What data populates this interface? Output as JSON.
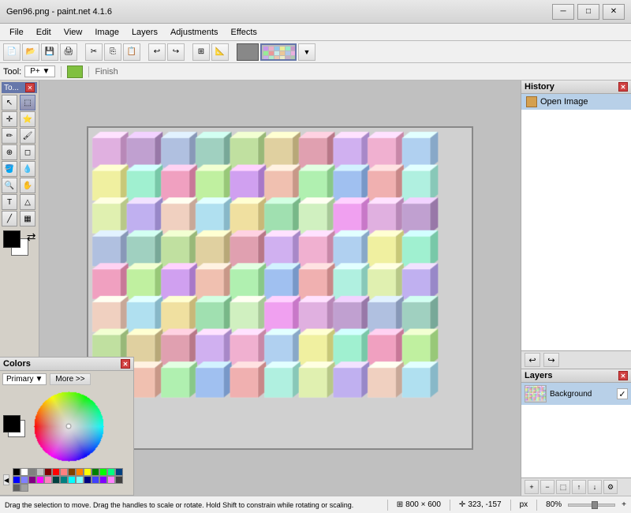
{
  "window": {
    "title": "Gen96.png - paint.net 4.1.6",
    "controls": {
      "minimize": "─",
      "maximize": "□",
      "close": "✕"
    }
  },
  "menu": {
    "items": [
      "File",
      "Edit",
      "View",
      "Image",
      "Layers",
      "Adjustments",
      "Effects"
    ]
  },
  "toolbar": {
    "buttons": [
      "new",
      "open",
      "save",
      "print",
      "sep",
      "cut",
      "copy",
      "paste",
      "sep",
      "undo",
      "redo",
      "sep",
      "grid",
      "ruler"
    ]
  },
  "tool_options": {
    "tool_label": "Tool:",
    "tool_value": "P+",
    "finish_label": "Finish"
  },
  "toolbox": {
    "title": "To...",
    "tools": [
      "↖",
      "⬚",
      "○",
      "⬜",
      "✏",
      "▱",
      "T",
      "⊕",
      "🪣",
      "💧",
      "🎨",
      "✂",
      "Σ",
      "∠"
    ]
  },
  "history": {
    "title": "History",
    "items": [
      {
        "label": "Open Image",
        "selected": true
      }
    ],
    "undo": "↩",
    "redo": "↪"
  },
  "layers": {
    "title": "Layers",
    "items": [
      {
        "label": "Background",
        "visible": true
      }
    ]
  },
  "colors": {
    "title": "Colors",
    "close": "✕",
    "mode": "Primary",
    "more_btn": "More >>",
    "palette": [
      "#000000",
      "#FFFFFF",
      "#808080",
      "#C0C0C0",
      "#800000",
      "#FF0000",
      "#FF8080",
      "#804000",
      "#FF8000",
      "#FFFF00",
      "#008000",
      "#00FF00",
      "#00FF80",
      "#004080",
      "#0000FF",
      "#8080FF",
      "#800080",
      "#FF00FF",
      "#FF80C0",
      "#004040",
      "#008080",
      "#00FFFF",
      "#80FFFF",
      "#000080",
      "#4040FF",
      "#8000FF",
      "#FF80FF",
      "#404040",
      "#606060",
      "#A0A0A0"
    ]
  },
  "status": {
    "text": "Drag the selection to move. Drag the handles to scale or rotate. Hold Shift to constrain while rotating or scaling.",
    "size": "800 × 600",
    "coords": "323, -157",
    "units": "px",
    "zoom": "80%"
  }
}
